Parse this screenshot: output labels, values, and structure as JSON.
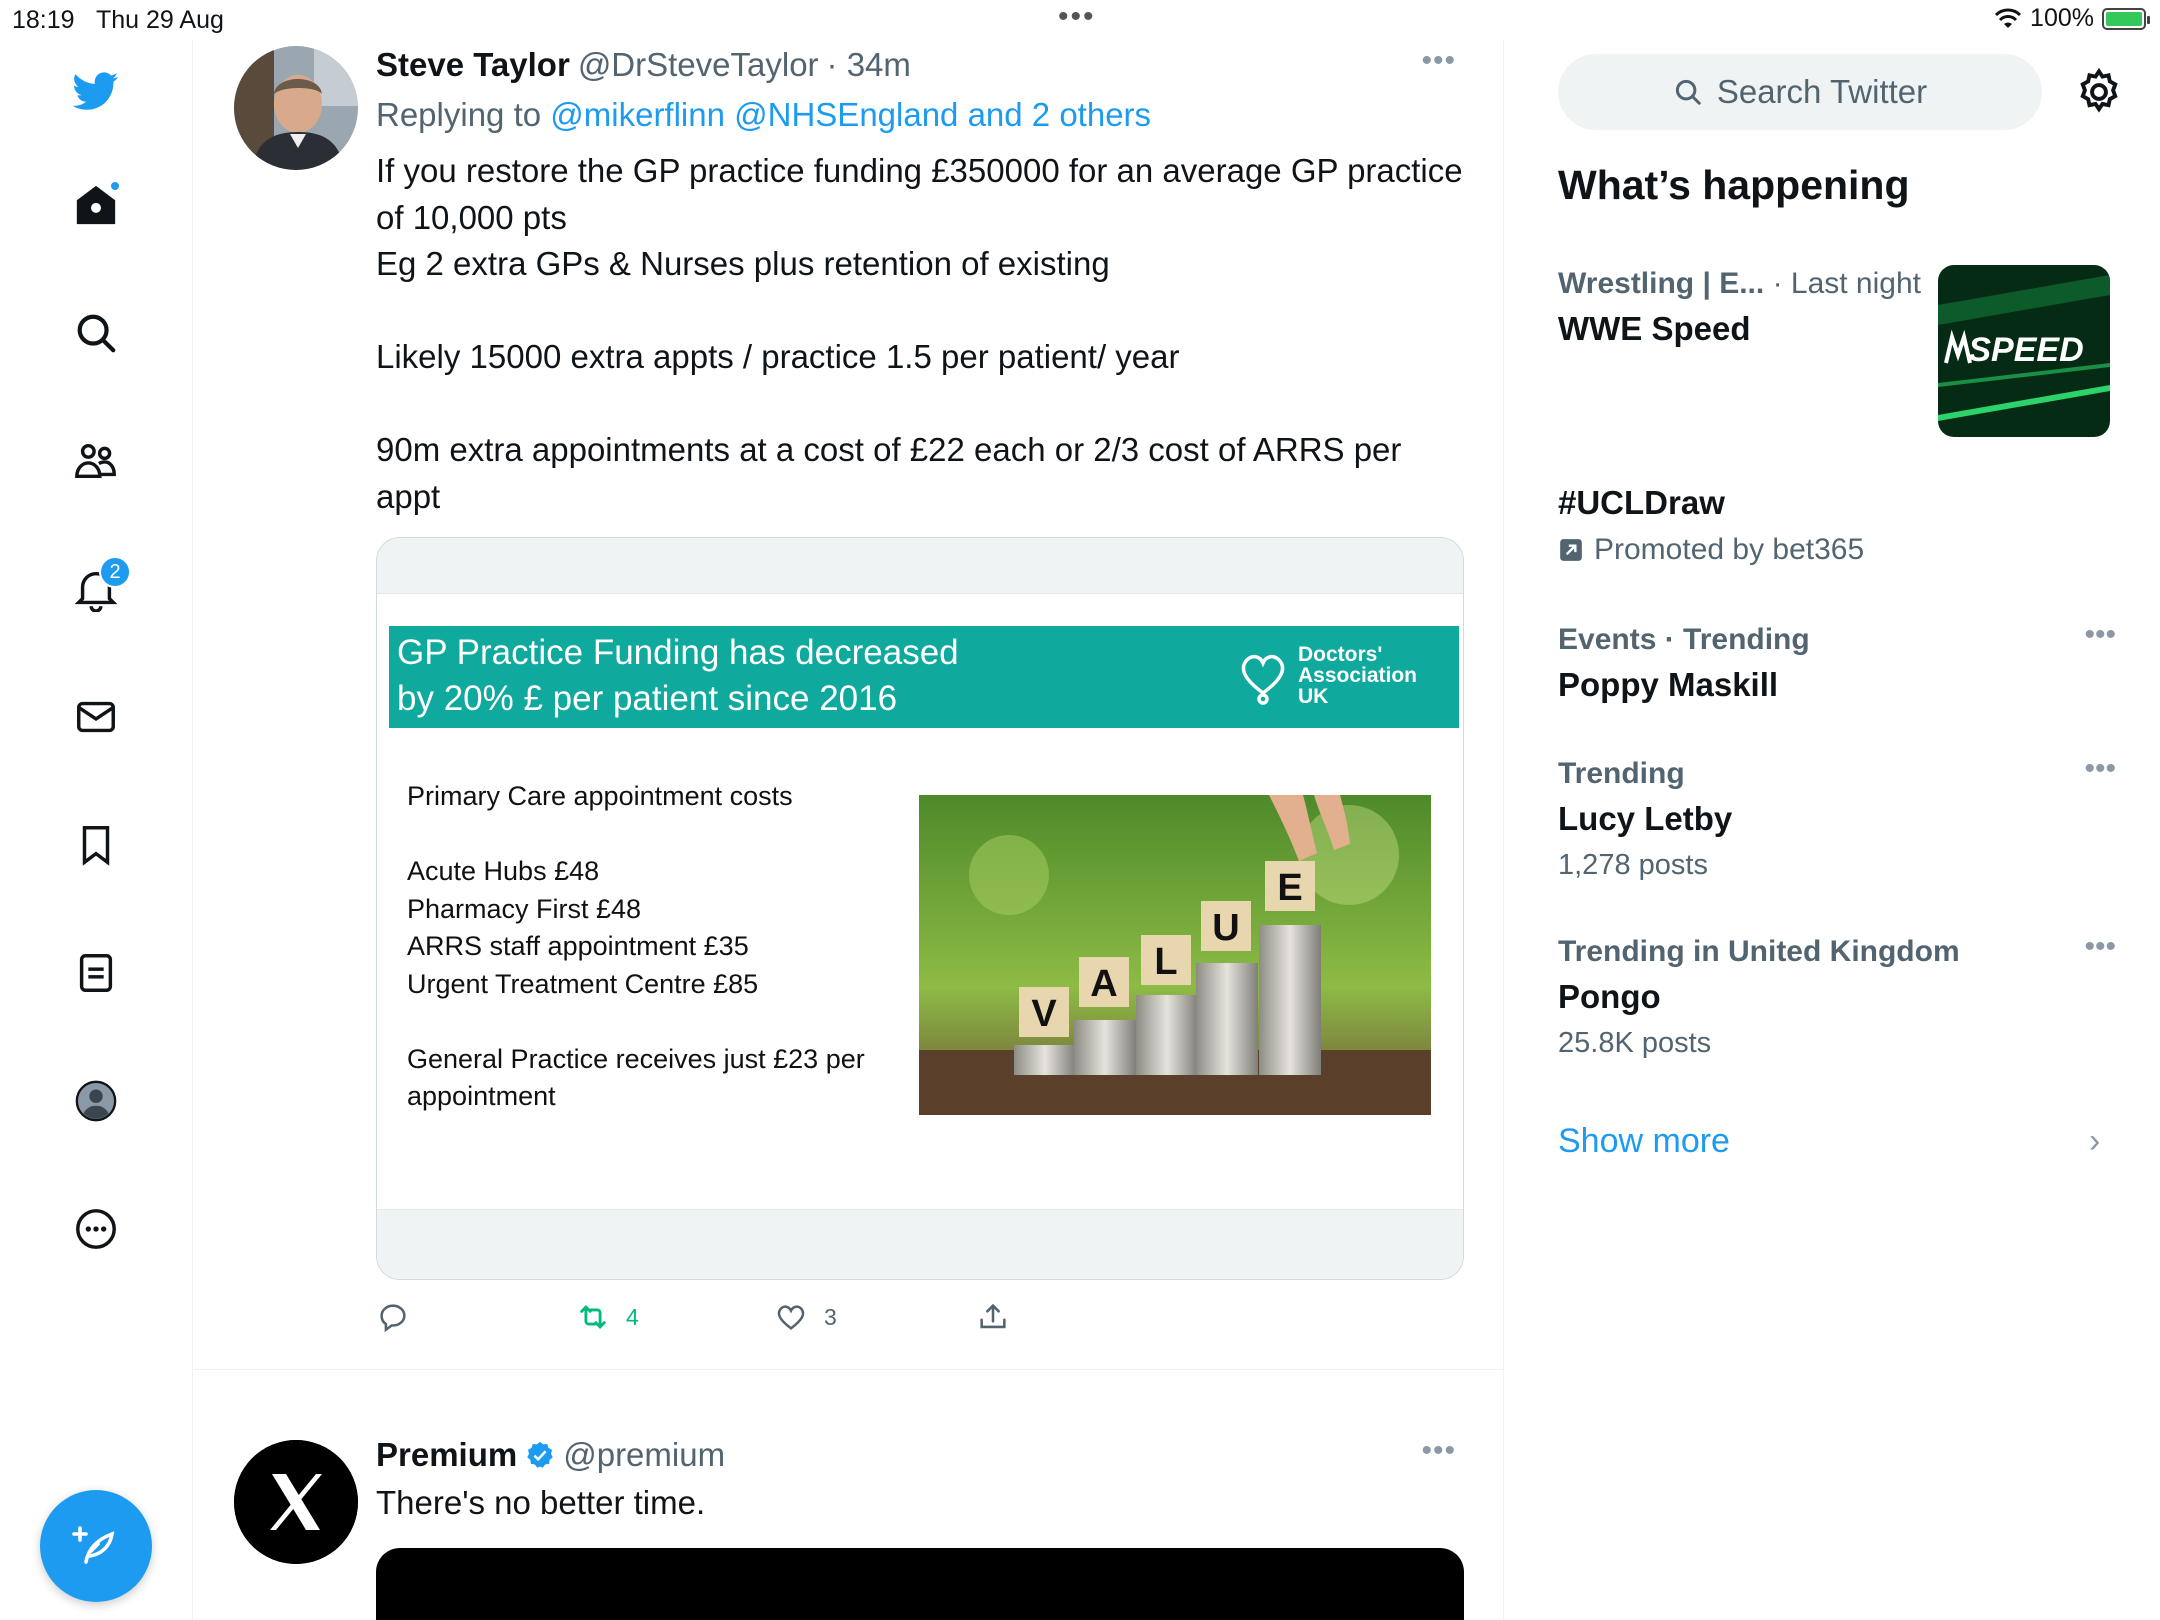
{
  "status_bar": {
    "time": "18:19",
    "date": "Thu 29 Aug",
    "battery": "100%"
  },
  "nav": {
    "notifications_count": "2",
    "items": [
      "home",
      "explore",
      "communities",
      "notifications",
      "messages",
      "bookmarks",
      "lists",
      "profile",
      "more"
    ]
  },
  "tweet1": {
    "name": "Steve Taylor",
    "handle": "@DrSteveTaylor",
    "time": "· 34m",
    "reply_prefix": "Replying to ",
    "reply_to": "@mikerflinn @NHSEngland and 2 others",
    "text": "If you restore the GP practice funding £350000 for an average GP practice of 10,000 pts\nEg 2 extra GPs & Nurses plus retention of existing\n\nLikely 15000 extra appts / practice 1.5 per patient/ year\n\n90m extra appointments at a cost of £22 each or 2/3 cost of ARRS per appt",
    "card": {
      "banner_title": "GP Practice Funding has decreased\nby 20% £ per patient since 2016",
      "logo_text": "Doctors'\nAssociation\nUK",
      "list": "Primary Care appointment costs\n\nAcute Hubs £48\nPharmacy First £48\nARRS staff appointment £35\nUrgent Treatment Centre £85\n\nGeneral Practice receives just £23 per\nappointment",
      "photo_letters": [
        "V",
        "A",
        "L",
        "U",
        "E"
      ]
    },
    "retweets": "4",
    "likes": "3"
  },
  "tweet2": {
    "name": "Premium",
    "handle": "@premium",
    "text": "There's no better time."
  },
  "right": {
    "search_placeholder": "Search Twitter",
    "section_title": "What’s happening",
    "trends": [
      {
        "meta_category": "Wrestling | E...",
        "meta_time": "· Last night",
        "name": "WWE Speed",
        "thumb_text": "SPEED"
      },
      {
        "name": "#UCLDraw",
        "promoted": "Promoted by bet365"
      },
      {
        "meta": "Events · Trending",
        "name": "Poppy Maskill"
      },
      {
        "meta": "Trending",
        "name": "Lucy Letby",
        "count": "1,278 posts"
      },
      {
        "meta": "Trending in United Kingdom",
        "name": "Pongo",
        "count": "25.8K posts"
      }
    ],
    "show_more": "Show more"
  },
  "colors": {
    "accent": "#1d9bf0",
    "retweet": "#00ba7c",
    "banner": "#10a99d"
  }
}
